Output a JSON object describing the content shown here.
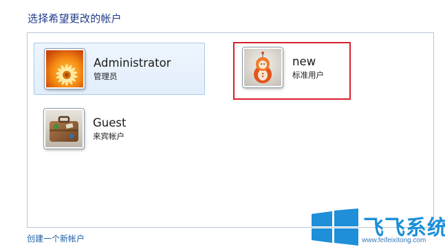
{
  "page": {
    "heading": "选择希望更改的帐户"
  },
  "accounts": [
    {
      "name": "Administrator",
      "type": "管理员",
      "avatar": "flower-avatar"
    },
    {
      "name": "new",
      "type": "标准用户",
      "avatar": "robot-toy-avatar"
    },
    {
      "name": "Guest",
      "type": "来宾帐户",
      "avatar": "suitcase-avatar"
    }
  ],
  "links": {
    "create_account": "创建一个新帐户"
  },
  "watermark": {
    "title": "飞飞系统",
    "url": "www.feifeixitong.com"
  },
  "colors": {
    "heading": "#1e3a8a",
    "link": "#1f5fa8",
    "selected_tile_bg": "#e2eefb",
    "highlight_border": "#d61f2a",
    "watermark_blue": "#1a8fd8"
  }
}
